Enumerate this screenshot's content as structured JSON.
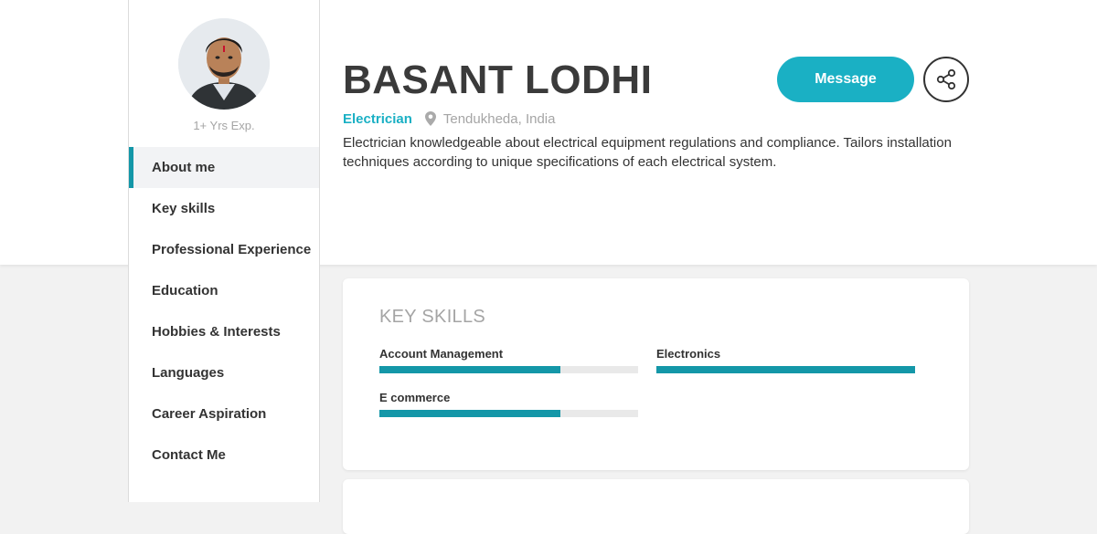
{
  "profile": {
    "name": "BASANT LODHI",
    "experience": "1+ Yrs Exp.",
    "role": "Electrician",
    "location": "Tendukheda, India",
    "summary": "Electrician knowledgeable about electrical equipment regulations and compliance. Tailors installation techniques according to unique specifications of each electrical system."
  },
  "actions": {
    "message_label": "Message",
    "share_icon": "share-icon"
  },
  "sidebar": {
    "items": [
      {
        "label": "About me",
        "active": true
      },
      {
        "label": "Key skills"
      },
      {
        "label": "Professional Experience"
      },
      {
        "label": "Education"
      },
      {
        "label": "Hobbies & Interests"
      },
      {
        "label": "Languages"
      },
      {
        "label": "Career Aspiration"
      },
      {
        "label": "Contact Me"
      }
    ]
  },
  "key_skills": {
    "title": "KEY SKILLS",
    "skills": [
      {
        "name": "Account Management",
        "level": 0.7
      },
      {
        "name": "Electronics",
        "level": 1.0
      },
      {
        "name": "E commerce",
        "level": 0.7
      }
    ]
  },
  "colors": {
    "accent": "#1ab0c4",
    "bar": "#1497a8",
    "muted": "#a5a5a5"
  }
}
